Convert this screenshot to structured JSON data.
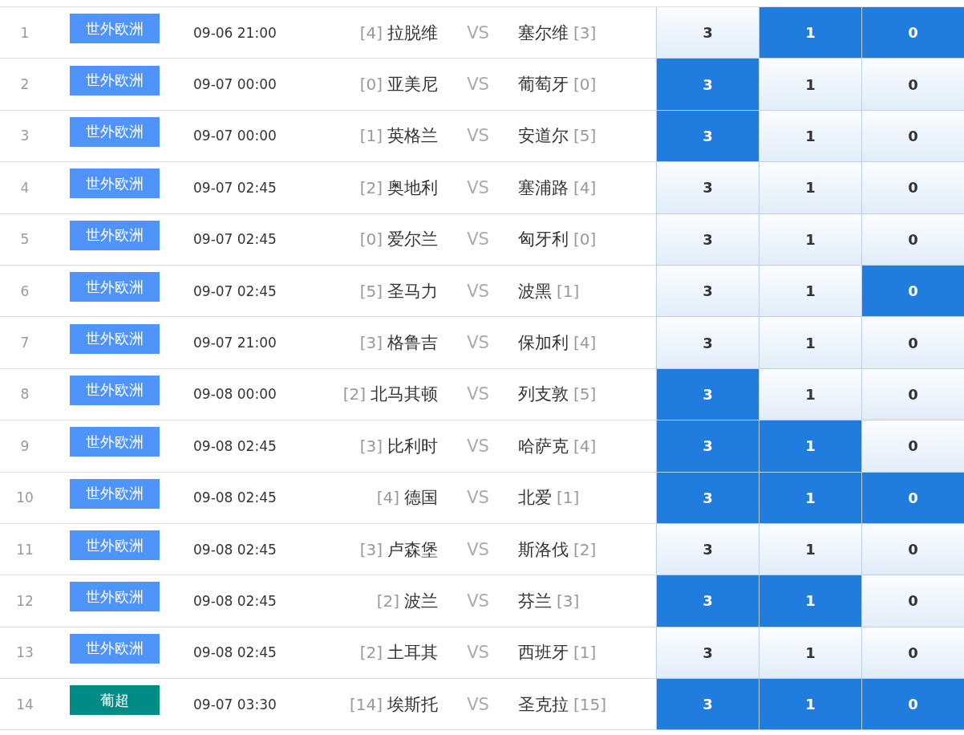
{
  "matches": [
    {
      "number": "1",
      "league": {
        "text": "世外欧洲",
        "color": "#4f94fb"
      },
      "time": "09-06 21:00",
      "home_rank": "[4]",
      "home": "拉脱维",
      "vs": "VS",
      "away": "塞尔维",
      "away_rank": "[3]",
      "odds": [
        {
          "value": "3",
          "selected": false
        },
        {
          "value": "1",
          "selected": true
        },
        {
          "value": "0",
          "selected": true
        }
      ]
    },
    {
      "number": "2",
      "league": {
        "text": "世外欧洲",
        "color": "#4f94fb"
      },
      "time": "09-07 00:00",
      "home_rank": "[0]",
      "home": "亚美尼",
      "vs": "VS",
      "away": "葡萄牙",
      "away_rank": "[0]",
      "odds": [
        {
          "value": "3",
          "selected": true
        },
        {
          "value": "1",
          "selected": false
        },
        {
          "value": "0",
          "selected": false
        }
      ]
    },
    {
      "number": "3",
      "league": {
        "text": "世外欧洲",
        "color": "#4f94fb"
      },
      "time": "09-07 00:00",
      "home_rank": "[1]",
      "home": "英格兰",
      "vs": "VS",
      "away": "安道尔",
      "away_rank": "[5]",
      "odds": [
        {
          "value": "3",
          "selected": true
        },
        {
          "value": "1",
          "selected": false
        },
        {
          "value": "0",
          "selected": false
        }
      ]
    },
    {
      "number": "4",
      "league": {
        "text": "世外欧洲",
        "color": "#4f94fb"
      },
      "time": "09-07 02:45",
      "home_rank": "[2]",
      "home": "奥地利",
      "vs": "VS",
      "away": "塞浦路",
      "away_rank": "[4]",
      "odds": [
        {
          "value": "3",
          "selected": false
        },
        {
          "value": "1",
          "selected": false
        },
        {
          "value": "0",
          "selected": false
        }
      ]
    },
    {
      "number": "5",
      "league": {
        "text": "世外欧洲",
        "color": "#4f94fb"
      },
      "time": "09-07 02:45",
      "home_rank": "[0]",
      "home": "爱尔兰",
      "vs": "VS",
      "away": "匈牙利",
      "away_rank": "[0]",
      "odds": [
        {
          "value": "3",
          "selected": false
        },
        {
          "value": "1",
          "selected": false
        },
        {
          "value": "0",
          "selected": false
        }
      ]
    },
    {
      "number": "6",
      "league": {
        "text": "世外欧洲",
        "color": "#4f94fb"
      },
      "time": "09-07 02:45",
      "home_rank": "[5]",
      "home": "圣马力",
      "vs": "VS",
      "away": "波黑",
      "away_rank": "[1]",
      "odds": [
        {
          "value": "3",
          "selected": false
        },
        {
          "value": "1",
          "selected": false
        },
        {
          "value": "0",
          "selected": true
        }
      ]
    },
    {
      "number": "7",
      "league": {
        "text": "世外欧洲",
        "color": "#4f94fb"
      },
      "time": "09-07 21:00",
      "home_rank": "[3]",
      "home": "格鲁吉",
      "vs": "VS",
      "away": "保加利",
      "away_rank": "[4]",
      "odds": [
        {
          "value": "3",
          "selected": false
        },
        {
          "value": "1",
          "selected": false
        },
        {
          "value": "0",
          "selected": false
        }
      ]
    },
    {
      "number": "8",
      "league": {
        "text": "世外欧洲",
        "color": "#4f94fb"
      },
      "time": "09-08 00:00",
      "home_rank": "[2]",
      "home": "北马其顿",
      "vs": "VS",
      "away": "列支敦",
      "away_rank": "[5]",
      "odds": [
        {
          "value": "3",
          "selected": true
        },
        {
          "value": "1",
          "selected": false
        },
        {
          "value": "0",
          "selected": false
        }
      ]
    },
    {
      "number": "9",
      "league": {
        "text": "世外欧洲",
        "color": "#4f94fb"
      },
      "time": "09-08 02:45",
      "home_rank": "[3]",
      "home": "比利时",
      "vs": "VS",
      "away": "哈萨克",
      "away_rank": "[4]",
      "odds": [
        {
          "value": "3",
          "selected": true
        },
        {
          "value": "1",
          "selected": true
        },
        {
          "value": "0",
          "selected": false
        }
      ]
    },
    {
      "number": "10",
      "league": {
        "text": "世外欧洲",
        "color": "#4f94fb"
      },
      "time": "09-08 02:45",
      "home_rank": "[4]",
      "home": "德国",
      "vs": "VS",
      "away": "北爱",
      "away_rank": "[1]",
      "odds": [
        {
          "value": "3",
          "selected": true
        },
        {
          "value": "1",
          "selected": true
        },
        {
          "value": "0",
          "selected": true
        }
      ]
    },
    {
      "number": "11",
      "league": {
        "text": "世外欧洲",
        "color": "#4f94fb"
      },
      "time": "09-08 02:45",
      "home_rank": "[3]",
      "home": "卢森堡",
      "vs": "VS",
      "away": "斯洛伐",
      "away_rank": "[2]",
      "odds": [
        {
          "value": "3",
          "selected": false
        },
        {
          "value": "1",
          "selected": false
        },
        {
          "value": "0",
          "selected": false
        }
      ]
    },
    {
      "number": "12",
      "league": {
        "text": "世外欧洲",
        "color": "#4f94fb"
      },
      "time": "09-08 02:45",
      "home_rank": "[2]",
      "home": "波兰",
      "vs": "VS",
      "away": "芬兰",
      "away_rank": "[3]",
      "odds": [
        {
          "value": "3",
          "selected": true
        },
        {
          "value": "1",
          "selected": true
        },
        {
          "value": "0",
          "selected": false
        }
      ]
    },
    {
      "number": "13",
      "league": {
        "text": "世外欧洲",
        "color": "#4f94fb"
      },
      "time": "09-08 02:45",
      "home_rank": "[2]",
      "home": "土耳其",
      "vs": "VS",
      "away": "西班牙",
      "away_rank": "[1]",
      "odds": [
        {
          "value": "3",
          "selected": false
        },
        {
          "value": "1",
          "selected": false
        },
        {
          "value": "0",
          "selected": false
        }
      ]
    },
    {
      "number": "14",
      "league": {
        "text": "葡超",
        "color": "#008b86"
      },
      "time": "09-07 03:30",
      "home_rank": "[14]",
      "home": "埃斯托",
      "vs": "VS",
      "away": "圣克拉",
      "away_rank": "[15]",
      "odds": [
        {
          "value": "3",
          "selected": true
        },
        {
          "value": "1",
          "selected": true
        },
        {
          "value": "0",
          "selected": true
        }
      ]
    }
  ]
}
